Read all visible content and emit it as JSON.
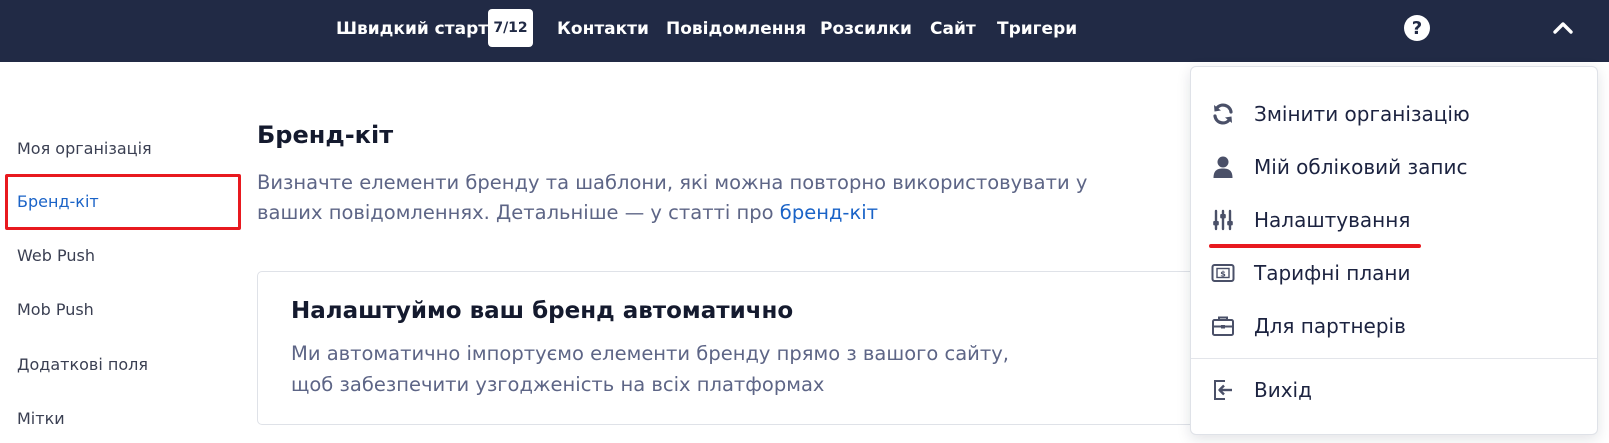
{
  "nav": {
    "quick_start": "Швидкий старт",
    "quick_start_progress": "7/12",
    "contacts": "Контакти",
    "messages": "Повідомлення",
    "campaigns": "Розсилки",
    "site": "Сайт",
    "triggers": "Тригери",
    "help_icon": "?",
    "icons": {
      "help": "question-circle-icon",
      "collapse": "chevron-up-icon"
    }
  },
  "sidebar": {
    "items": [
      {
        "label": "Моя організація",
        "active": false
      },
      {
        "label": "Бренд-кіт",
        "active": true
      },
      {
        "label": "Web Push",
        "active": false
      },
      {
        "label": "Mob Push",
        "active": false
      },
      {
        "label": "Додаткові поля",
        "active": false
      },
      {
        "label": "Мітки",
        "active": false
      }
    ]
  },
  "main": {
    "title": "Бренд-кіт",
    "description": "Визначте елементи бренду та шаблони, які можна повторно використовувати у ваших повідомленнях. Детальніше — у статті про ",
    "description_link": "бренд-кіт",
    "card": {
      "title": "Налаштуймо ваш бренд автоматично",
      "description": "Ми автоматично імпортуємо елементи бренду прямо з вашого сайту, щоб забезпечити узгодженість на всіх платформах"
    }
  },
  "dropdown": {
    "items": [
      {
        "label": "Змінити організацію",
        "icon": "sync-icon"
      },
      {
        "label": "Мій обліковий запис",
        "icon": "user-icon"
      },
      {
        "label": "Налаштування",
        "icon": "sliders-icon",
        "highlighted": true
      },
      {
        "label": "Тарифні плани",
        "icon": "money-bill-icon"
      },
      {
        "label": "Для партнерів",
        "icon": "briefcase-icon"
      },
      {
        "label": "Вихід",
        "icon": "sign-out-icon"
      }
    ]
  },
  "colors": {
    "topbar": "#212a45",
    "accent_link": "#1a63c7",
    "highlight_red": "#e8191f",
    "muted_text": "#5d6586"
  }
}
